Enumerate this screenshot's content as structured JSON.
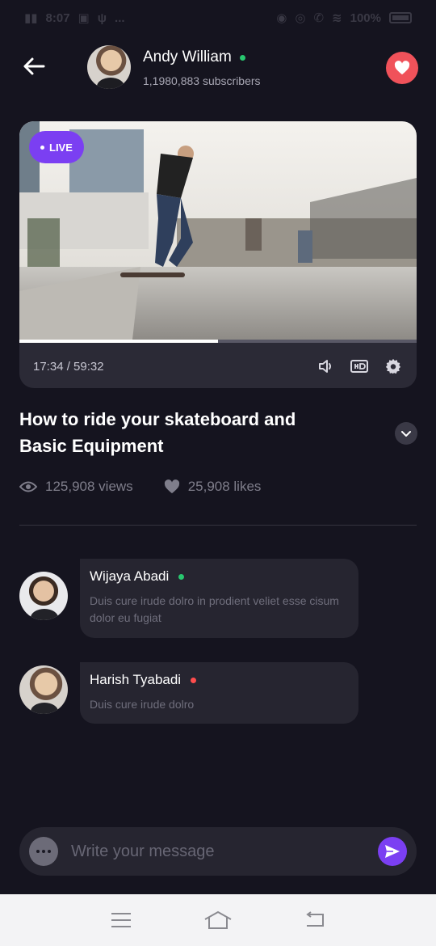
{
  "status_bar": {
    "time": "8:07",
    "extra": "...",
    "battery": "100%"
  },
  "channel": {
    "name": "Andy William",
    "subscribers": "1,1980,883 subscribers",
    "online": true
  },
  "video": {
    "live_label": "LIVE",
    "time_readout": "17:34 / 59:32",
    "progress_fraction": 0.5,
    "title": "How to ride your skateboard and Basic Equipment",
    "views": "125,908 views",
    "likes": "25,908 likes"
  },
  "comments": [
    {
      "author": "Wijaya Abadi",
      "text": "Duis cure irude dolro in prodient veliet esse cisum dolor eu fugiat",
      "status": "online"
    },
    {
      "author": "Harish Tyabadi",
      "text": "Duis cure irude dolro",
      "status": "offline"
    }
  ],
  "composer": {
    "placeholder": "Write your message"
  },
  "colors": {
    "background": "#15141f",
    "accent": "#7b3ff2",
    "favorite": "#f0525a",
    "online": "#28c76f",
    "offline": "#ff4d4d"
  },
  "icons": {
    "back": "arrow-left-icon",
    "favorite": "heart-icon",
    "volume": "speaker-icon",
    "quality": "hd-icon",
    "settings": "gear-icon",
    "expand": "chevron-down-icon",
    "views": "eye-icon",
    "likes": "heart-icon",
    "more": "dots-icon",
    "send": "send-icon"
  }
}
